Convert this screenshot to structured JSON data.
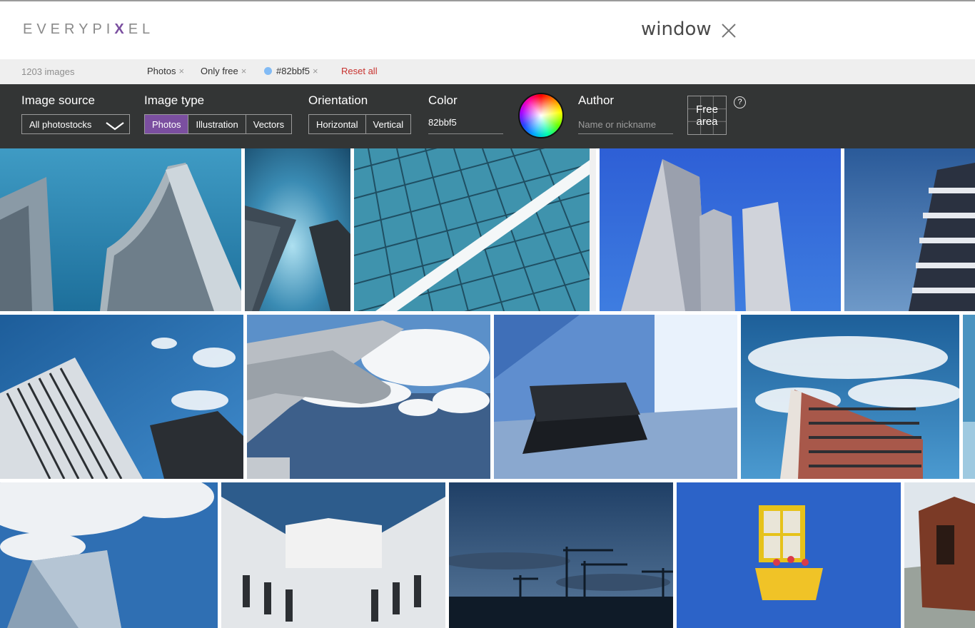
{
  "header": {
    "logo_pre": "EVERYPI",
    "logo_x": "X",
    "logo_post": "EL",
    "search_query": "window"
  },
  "filterbar": {
    "count": "1203 images",
    "chips": [
      {
        "label": "Photos"
      },
      {
        "label": "Only free"
      },
      {
        "label": "#82bbf5",
        "color": "#82bbf5"
      }
    ],
    "remove_glyph": "×",
    "reset_label": "Reset all"
  },
  "panel": {
    "image_source": {
      "label": "Image source",
      "value": "All photostocks"
    },
    "image_type": {
      "label": "Image type",
      "options": [
        "Photos",
        "Illustration",
        "Vectors"
      ],
      "selected": "Photos"
    },
    "orientation": {
      "label": "Orientation",
      "options": [
        "Horizontal",
        "Vertical"
      ]
    },
    "color": {
      "label": "Color",
      "value": "82bbf5"
    },
    "author": {
      "label": "Author",
      "placeholder": "Name or nickname"
    },
    "free_area": {
      "line1": "Free",
      "line2": "area"
    },
    "help": "?"
  },
  "colors": {
    "accent": "#7b4fa0",
    "panel_bg": "#333535",
    "reset": "#c8332f",
    "selected_color": "#82bbf5"
  },
  "photos": [
    {
      "subject": "curved towers against blue sky"
    },
    {
      "subject": "two skyscrapers from below"
    },
    {
      "subject": "glass facade diagonal"
    },
    {
      "subject": "three towers blue sky"
    },
    {
      "subject": "balcony building"
    },
    {
      "subject": "skyscrapers with clouds"
    },
    {
      "subject": "airplane wing over clouds"
    },
    {
      "subject": "black bench by window"
    },
    {
      "subject": "brick apartment block"
    },
    {
      "subject": "glass tower and clouds"
    },
    {
      "subject": "white building corner"
    },
    {
      "subject": "cranes at dusk"
    },
    {
      "subject": "yellow window in blue wall"
    },
    {
      "subject": "wooden shack"
    }
  ]
}
